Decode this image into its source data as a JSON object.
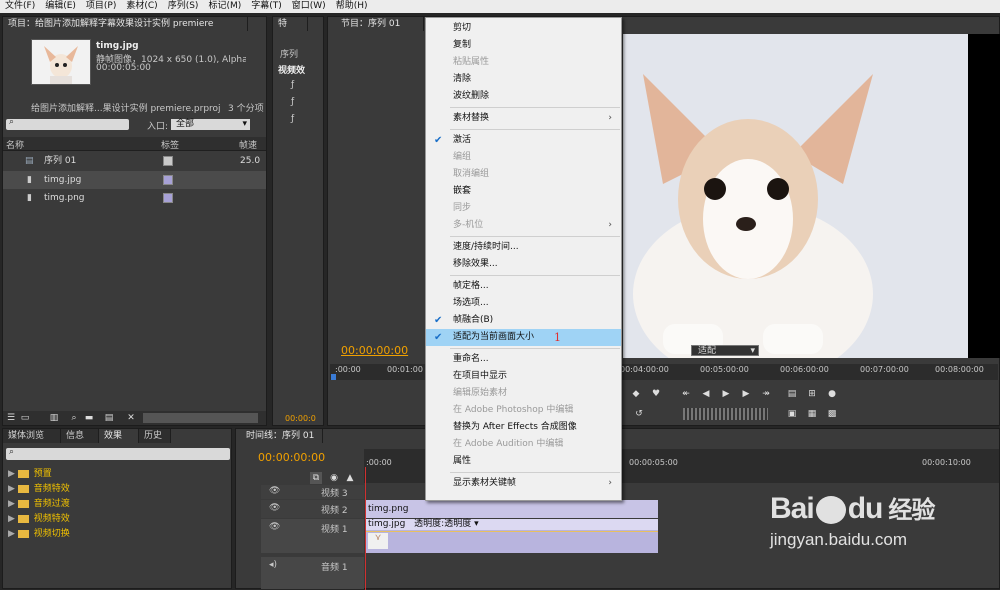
{
  "menubar": {
    "items": [
      "文件(F)",
      "编辑(E)",
      "项目(P)",
      "素材(C)",
      "序列(S)",
      "标记(M)",
      "字幕(T)",
      "窗口(W)",
      "帮助(H)"
    ]
  },
  "project": {
    "tab": "项目：给图片添加解释字幕效果设计实例 premiere",
    "preview_name": "timg.jpg",
    "preview_info": "静帧图像，1024 x 650 (1.0), Alpha",
    "preview_dur": "00:00:05:00",
    "proj_path": "给图片添加解释...果设计实例 premiere.prproj",
    "item_count": "3 个分项",
    "in_label": "入口:",
    "in_value": "全部",
    "headers": [
      "名称",
      "标签",
      "帧速"
    ],
    "rows": [
      {
        "name": "序列 01",
        "label_color": "#c9c9c9",
        "rate": "25.0"
      },
      {
        "name": "timg.jpg",
        "label_color": "#a7a1d6",
        "rate": ""
      },
      {
        "name": "timg.png",
        "label_color": "#a7a1d6",
        "rate": ""
      }
    ]
  },
  "effect_ctrl": {
    "tab": "特",
    "sub1": "序列",
    "sub2": "视频效",
    "tc": "00:00:0"
  },
  "program": {
    "tab": "节目：序列 01",
    "timecode": "00:00:00:00",
    "fit": "适配",
    "ruler": [
      ":00:00",
      "00:01:00",
      "00:04:00:00",
      "00:05:00:00",
      "00:06:00:00",
      "00:07:00:00",
      "00:08:00:00"
    ]
  },
  "context_menu": {
    "items": [
      {
        "label": "剪切",
        "state": "enabled"
      },
      {
        "label": "复制",
        "state": "enabled"
      },
      {
        "label": "粘贴属性",
        "state": "disabled"
      },
      {
        "label": "清除",
        "state": "enabled"
      },
      {
        "label": "波纹删除",
        "state": "enabled"
      },
      {
        "sep": true
      },
      {
        "label": "素材替换",
        "state": "enabled",
        "submenu": true
      },
      {
        "sep": true
      },
      {
        "label": "激活",
        "state": "enabled",
        "checked": true
      },
      {
        "label": "编组",
        "state": "disabled"
      },
      {
        "label": "取消编组",
        "state": "disabled"
      },
      {
        "label": "嵌套",
        "state": "enabled"
      },
      {
        "label": "同步",
        "state": "disabled"
      },
      {
        "label": "多-机位",
        "state": "disabled",
        "submenu": true
      },
      {
        "sep": true
      },
      {
        "label": "速度/持续时间...",
        "state": "enabled"
      },
      {
        "label": "移除效果...",
        "state": "enabled"
      },
      {
        "sep": true
      },
      {
        "label": "帧定格...",
        "state": "enabled"
      },
      {
        "label": "场选项...",
        "state": "enabled"
      },
      {
        "label": "帧融合(B)",
        "state": "enabled",
        "checked": true
      },
      {
        "label": "适配为当前画面大小",
        "state": "highlighted",
        "checked": true,
        "annotation": "1"
      },
      {
        "sep": true
      },
      {
        "label": "重命名...",
        "state": "enabled"
      },
      {
        "label": "在项目中显示",
        "state": "enabled"
      },
      {
        "label": "编辑原始素材",
        "state": "disabled"
      },
      {
        "label": "在 Adobe Photoshop 中编辑",
        "state": "disabled"
      },
      {
        "label": "替换为 After Effects 合成图像",
        "state": "enabled"
      },
      {
        "label": "在 Adobe Audition 中编辑",
        "state": "disabled"
      },
      {
        "label": "属性",
        "state": "enabled"
      },
      {
        "sep": true
      },
      {
        "label": "显示素材关键帧",
        "state": "enabled",
        "submenu": true
      }
    ]
  },
  "effects": {
    "tabs": [
      "媒体浏览",
      "信息",
      "效果",
      "历史"
    ],
    "folders": [
      "预置",
      "音频特效",
      "音频过渡",
      "视频特效",
      "视频切换"
    ]
  },
  "timeline": {
    "tab": "时间线：序列 01",
    "timecode": "00:00:00:00",
    "ruler": [
      ":00:00",
      "00:00:05:00",
      "00:00:10:00"
    ],
    "tracks": [
      {
        "name": "视频 3"
      },
      {
        "name": "视频 2"
      },
      {
        "name": "视频 1"
      },
      {
        "name": "音频 1"
      }
    ],
    "clip_png": "timg.png",
    "clip_jpg": "timg.jpg",
    "clip_fx": "透明度:透明度"
  },
  "watermark": {
    "brand": "Bai",
    "brand2": "du",
    "suffix": "经验",
    "url": "jingyan.baidu.com"
  }
}
